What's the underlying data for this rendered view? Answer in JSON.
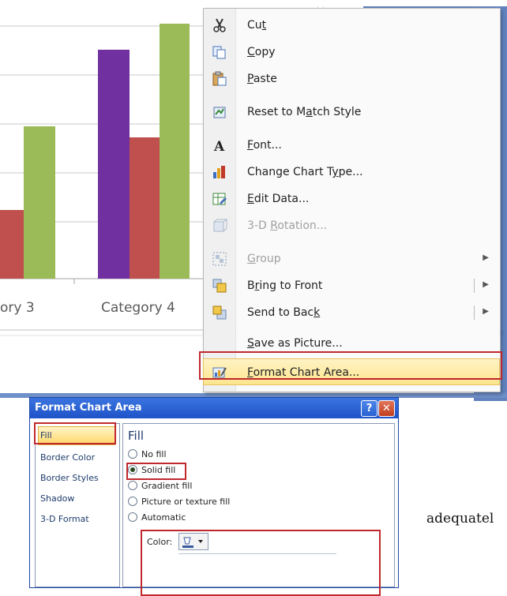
{
  "chart": {
    "categories": [
      "ory 3",
      "Category 4"
    ],
    "colors": {
      "purple": "#7030a0",
      "red": "#c0504d",
      "green": "#9bbb59"
    }
  },
  "context_menu": {
    "items": [
      {
        "label": "Cut",
        "mnemonic": "t",
        "icon": "scissors-icon",
        "disabled": false
      },
      {
        "label": "Copy",
        "mnemonic": "C",
        "icon": "copy-icon",
        "disabled": false
      },
      {
        "label": "Paste",
        "mnemonic": "P",
        "icon": "paste-icon",
        "disabled": false
      },
      {
        "label": "Reset to Match Style",
        "mnemonic": "a",
        "icon": "reset-style-icon",
        "disabled": false
      },
      {
        "label": "Font...",
        "mnemonic": "F",
        "icon": "font-icon",
        "disabled": false
      },
      {
        "label": "Change Chart Type...",
        "mnemonic": "y",
        "icon": "chart-type-icon",
        "disabled": false
      },
      {
        "label": "Edit Data...",
        "mnemonic": "E",
        "icon": "edit-data-icon",
        "disabled": false
      },
      {
        "label": "3-D Rotation...",
        "mnemonic": "R",
        "icon": "rotation-icon",
        "disabled": true
      },
      {
        "label": "Group",
        "mnemonic": "G",
        "icon": "group-icon",
        "disabled": true
      },
      {
        "label": "Bring to Front",
        "mnemonic": "r",
        "icon": "bring-front-icon",
        "disabled": false
      },
      {
        "label": "Send to Back",
        "mnemonic": "k",
        "icon": "send-back-icon",
        "disabled": false
      },
      {
        "label": "Save as Picture...",
        "mnemonic": "S",
        "icon": "",
        "disabled": false
      },
      {
        "label": "Format Chart Area...",
        "mnemonic": "F",
        "icon": "format-chart-icon",
        "disabled": false
      }
    ]
  },
  "dialog": {
    "title": "Format Chart Area",
    "help_label": "?",
    "close_label": "✕",
    "nav": [
      "Fill",
      "Border Color",
      "Border Styles",
      "Shadow",
      "3-D Format"
    ],
    "section_title": "Fill",
    "options": [
      "No fill",
      "Solid fill",
      "Gradient fill",
      "Picture or texture fill",
      "Automatic"
    ],
    "selected_option": "Solid fill",
    "color_label": "Color:"
  },
  "page_text": "adequatel"
}
